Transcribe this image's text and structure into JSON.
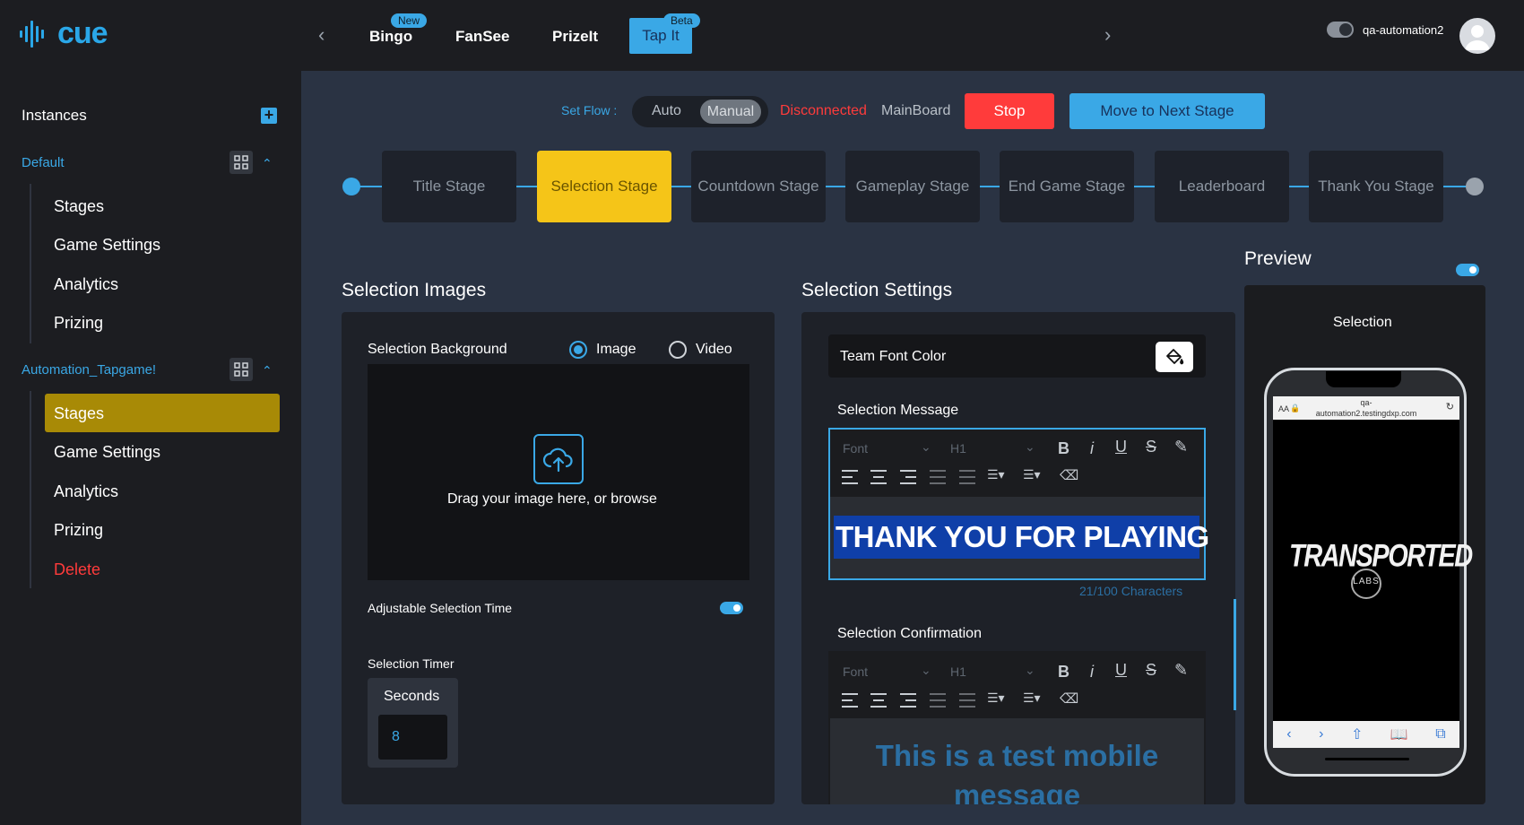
{
  "app": {
    "logo_text": "cue",
    "brand_color": "#3aa8e6"
  },
  "topnav": {
    "items": [
      {
        "label": "Bingo",
        "badge": "New"
      },
      {
        "label": "FanSee"
      },
      {
        "label": "PrizeIt"
      },
      {
        "label": "Tap It",
        "badge": "Beta",
        "active": true
      }
    ],
    "username": "qa-automation2"
  },
  "sidebar": {
    "title": "Instances",
    "groups": [
      {
        "name": "Default",
        "items": [
          "Stages",
          "Game Settings",
          "Analytics",
          "Prizing"
        ]
      },
      {
        "name": "Automation_Tapgame!",
        "items": [
          "Stages",
          "Game Settings",
          "Analytics",
          "Prizing",
          "Delete"
        ],
        "active_item": "Stages"
      }
    ]
  },
  "flow": {
    "set_flow_label": "Set Flow :",
    "auto": "Auto",
    "manual": "Manual",
    "status": "Disconnected",
    "board": "MainBoard",
    "stop": "Stop",
    "next": "Move to Next Stage"
  },
  "stages": [
    "Title Stage",
    "Selection Stage",
    "Countdown Stage",
    "Gameplay Stage",
    "End Game Stage",
    "Leaderboard",
    "Thank You Stage"
  ],
  "active_stage": "Selection Stage",
  "images": {
    "title": "Selection Images",
    "background_label": "Selection Background",
    "image_opt": "Image",
    "video_opt": "Video",
    "drop_text": "Drag your image here, or browse",
    "adjustable_label": "Adjustable Selection Time",
    "timer_label": "Selection Timer",
    "seconds_label": "Seconds",
    "seconds_value": "8"
  },
  "settings": {
    "title": "Selection Settings",
    "team_font_color": "Team Font Color",
    "message_label": "Selection Message",
    "font_placeholder": "Font",
    "heading_value": "H1",
    "message_text": "THANK YOU FOR PLAYING",
    "char_count": "21/100 Characters",
    "confirmation_label": "Selection Confirmation",
    "confirmation_text": "This is a test mobile message"
  },
  "preview": {
    "title": "Preview",
    "screen_title": "Selection",
    "url": "qa-automation2.testingdxp.com",
    "url_line1": "qa-",
    "url_line2": "automation2.testingdxp.com",
    "aa": "AA",
    "logo_text": "TRANSPORTED",
    "logo_sub": "LABS"
  }
}
